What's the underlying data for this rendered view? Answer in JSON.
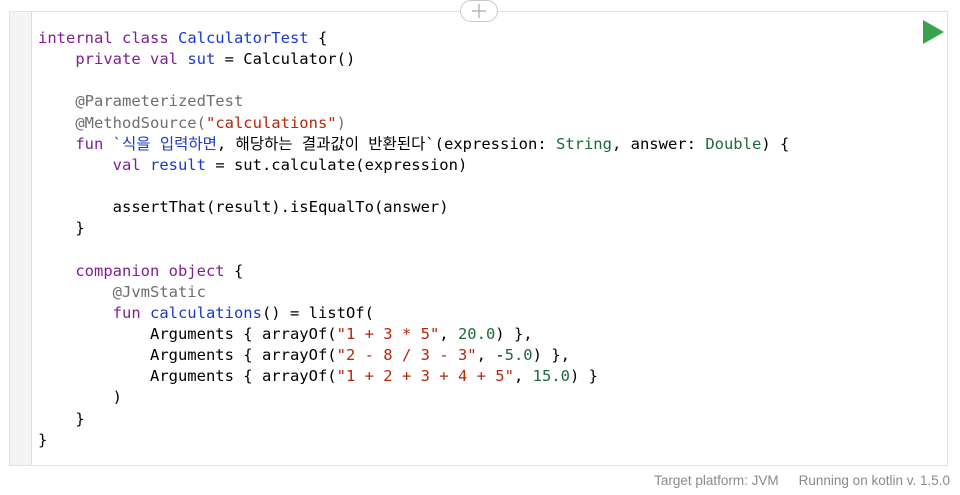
{
  "editor": {
    "add_icon": "plus-icon",
    "run_icon": "play-icon",
    "colors": {
      "keyword": "#7f1f93",
      "identifier": "#1a3acb",
      "annotation": "#6e6e6e",
      "string": "#b5270b",
      "number": "#1b6b3a",
      "run_button": "#3aa24a"
    },
    "lines": [
      [
        {
          "t": "kw",
          "v": "internal class "
        },
        {
          "t": "id",
          "v": "CalculatorTest"
        },
        {
          "t": "plain",
          "v": " {"
        }
      ],
      [
        {
          "t": "plain",
          "v": "    "
        },
        {
          "t": "kw",
          "v": "private val "
        },
        {
          "t": "id",
          "v": "sut"
        },
        {
          "t": "plain",
          "v": " = Calculator()"
        }
      ],
      [
        {
          "t": "plain",
          "v": ""
        }
      ],
      [
        {
          "t": "plain",
          "v": "    "
        },
        {
          "t": "ann",
          "v": "@ParameterizedTest"
        }
      ],
      [
        {
          "t": "plain",
          "v": "    "
        },
        {
          "t": "ann",
          "v": "@MethodSource("
        },
        {
          "t": "str",
          "v": "\"calculations\""
        },
        {
          "t": "ann",
          "v": ")"
        }
      ],
      [
        {
          "t": "plain",
          "v": "    "
        },
        {
          "t": "kw",
          "v": "fun "
        },
        {
          "t": "id",
          "v": "`식을 입력하면"
        },
        {
          "t": "plain",
          "v": ", 해당하는 결과값이 반환된다`(expression: "
        },
        {
          "t": "type",
          "v": "String"
        },
        {
          "t": "plain",
          "v": ", answer: "
        },
        {
          "t": "type",
          "v": "Double"
        },
        {
          "t": "plain",
          "v": ") {"
        }
      ],
      [
        {
          "t": "plain",
          "v": "        "
        },
        {
          "t": "kw",
          "v": "val "
        },
        {
          "t": "id",
          "v": "result"
        },
        {
          "t": "plain",
          "v": " = sut.calculate(expression)"
        }
      ],
      [
        {
          "t": "plain",
          "v": ""
        }
      ],
      [
        {
          "t": "plain",
          "v": "        assertThat(result).isEqualTo(answer)"
        }
      ],
      [
        {
          "t": "plain",
          "v": "    }"
        }
      ],
      [
        {
          "t": "plain",
          "v": ""
        }
      ],
      [
        {
          "t": "plain",
          "v": "    "
        },
        {
          "t": "kw",
          "v": "companion object "
        },
        {
          "t": "plain",
          "v": "{"
        }
      ],
      [
        {
          "t": "plain",
          "v": "        "
        },
        {
          "t": "ann",
          "v": "@JvmStatic"
        }
      ],
      [
        {
          "t": "plain",
          "v": "        "
        },
        {
          "t": "kw",
          "v": "fun "
        },
        {
          "t": "fn",
          "v": "calculations"
        },
        {
          "t": "plain",
          "v": "() = listOf("
        }
      ],
      [
        {
          "t": "plain",
          "v": "            Arguments { arrayOf("
        },
        {
          "t": "str",
          "v": "\"1 + 3 * 5\""
        },
        {
          "t": "plain",
          "v": ", "
        },
        {
          "t": "num",
          "v": "20.0"
        },
        {
          "t": "plain",
          "v": ") },"
        }
      ],
      [
        {
          "t": "plain",
          "v": "            Arguments { arrayOf("
        },
        {
          "t": "str",
          "v": "\"2 - 8 / 3 - 3\""
        },
        {
          "t": "plain",
          "v": ", -"
        },
        {
          "t": "num",
          "v": "5.0"
        },
        {
          "t": "plain",
          "v": ") },"
        }
      ],
      [
        {
          "t": "plain",
          "v": "            Arguments { arrayOf("
        },
        {
          "t": "str",
          "v": "\"1 + 2 + 3 + 4 + 5\""
        },
        {
          "t": "plain",
          "v": ", "
        },
        {
          "t": "num",
          "v": "15.0"
        },
        {
          "t": "plain",
          "v": ") }"
        }
      ],
      [
        {
          "t": "plain",
          "v": "        )"
        }
      ],
      [
        {
          "t": "plain",
          "v": "    }"
        }
      ],
      [
        {
          "t": "plain",
          "v": "}"
        }
      ]
    ]
  },
  "footer": {
    "target_platform": "Target platform: JVM",
    "running_on": "Running on kotlin v. 1.5.0"
  }
}
